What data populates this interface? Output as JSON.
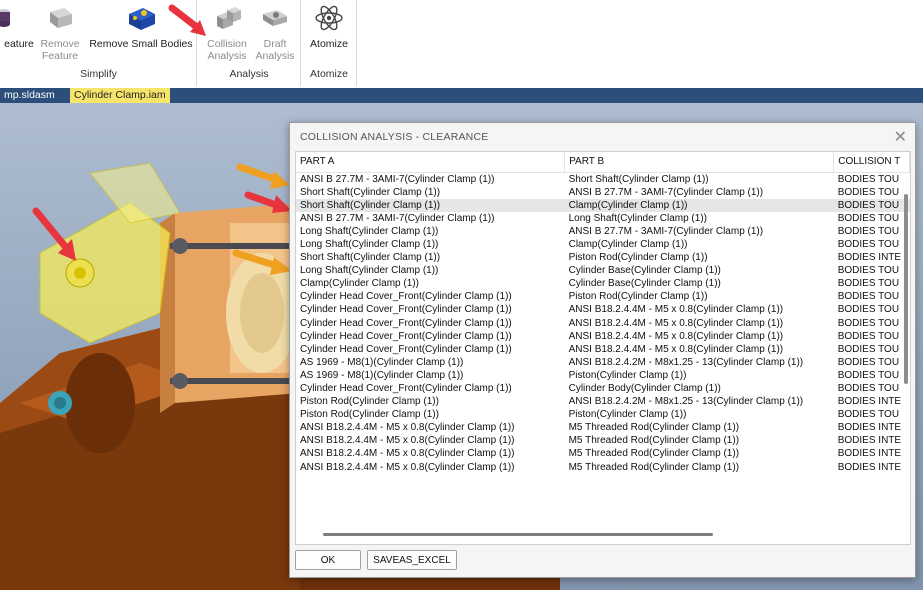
{
  "ribbon": {
    "groups": [
      {
        "label": "Simplify"
      },
      {
        "label": "Analysis"
      },
      {
        "label": "Atomize"
      }
    ],
    "buttons": {
      "feature": "eature",
      "remove_feature": "Remove\nFeature",
      "remove_small_bodies": "Remove Small Bodies",
      "collision_analysis": "Collision\nAnalysis",
      "draft_analysis": "Draft\nAnalysis",
      "atomize": "Atomize"
    }
  },
  "doc_tabs": [
    "mp.sldasm",
    "Cylinder Clamp.iam"
  ],
  "dialog": {
    "title": "COLLISION ANALYSIS - CLEARANCE",
    "columns": [
      "PART A",
      "PART B",
      "COLLISION T"
    ],
    "rows": [
      [
        "ANSI B 27.7M - 3AMI-7(Cylinder Clamp (1))",
        "Short Shaft(Cylinder Clamp (1))",
        "BODIES TOU"
      ],
      [
        "Short Shaft(Cylinder Clamp (1))",
        "ANSI B 27.7M - 3AMI-7(Cylinder Clamp (1))",
        "BODIES TOU"
      ],
      [
        "Short Shaft(Cylinder Clamp (1))",
        "Clamp(Cylinder Clamp (1))",
        "BODIES TOU"
      ],
      [
        "ANSI B 27.7M - 3AMI-7(Cylinder Clamp (1))",
        "Long Shaft(Cylinder Clamp (1))",
        "BODIES TOU"
      ],
      [
        "Long Shaft(Cylinder Clamp (1))",
        "ANSI B 27.7M - 3AMI-7(Cylinder Clamp (1))",
        "BODIES TOU"
      ],
      [
        "Long Shaft(Cylinder Clamp (1))",
        "Clamp(Cylinder Clamp (1))",
        "BODIES TOU"
      ],
      [
        "Short Shaft(Cylinder Clamp (1))",
        "Piston Rod(Cylinder Clamp (1))",
        "BODIES INTE"
      ],
      [
        "Long Shaft(Cylinder Clamp (1))",
        "Cylinder Base(Cylinder Clamp (1))",
        "BODIES TOU"
      ],
      [
        "Clamp(Cylinder Clamp (1))",
        "Cylinder Base(Cylinder Clamp (1))",
        "BODIES TOU"
      ],
      [
        "Cylinder Head Cover_Front(Cylinder Clamp (1))",
        "Piston Rod(Cylinder Clamp (1))",
        "BODIES TOU"
      ],
      [
        "Cylinder Head Cover_Front(Cylinder Clamp (1))",
        "ANSI B18.2.4.4M - M5 x 0.8(Cylinder Clamp (1))",
        "BODIES TOU"
      ],
      [
        "Cylinder Head Cover_Front(Cylinder Clamp (1))",
        "ANSI B18.2.4.4M - M5 x 0.8(Cylinder Clamp (1))",
        "BODIES TOU"
      ],
      [
        "Cylinder Head Cover_Front(Cylinder Clamp (1))",
        "ANSI B18.2.4.4M - M5 x 0.8(Cylinder Clamp (1))",
        "BODIES TOU"
      ],
      [
        "Cylinder Head Cover_Front(Cylinder Clamp (1))",
        "ANSI B18.2.4.4M - M5 x 0.8(Cylinder Clamp (1))",
        "BODIES TOU"
      ],
      [
        "AS 1969 - M8(1)(Cylinder Clamp (1))",
        "ANSI B18.2.4.2M - M8x1.25 - 13(Cylinder Clamp (1))",
        "BODIES TOU"
      ],
      [
        "AS 1969 - M8(1)(Cylinder Clamp (1))",
        "Piston(Cylinder Clamp (1))",
        "BODIES TOU"
      ],
      [
        "Cylinder Head Cover_Front(Cylinder Clamp (1))",
        "Cylinder Body(Cylinder Clamp (1))",
        "BODIES TOU"
      ],
      [
        "Piston Rod(Cylinder Clamp (1))",
        "ANSI B18.2.4.2M - M8x1.25 - 13(Cylinder Clamp (1))",
        "BODIES INTE"
      ],
      [
        "Piston Rod(Cylinder Clamp (1))",
        "Piston(Cylinder Clamp (1))",
        "BODIES TOU"
      ],
      [
        "ANSI B18.2.4.4M - M5 x 0.8(Cylinder Clamp (1))",
        "M5 Threaded Rod(Cylinder Clamp (1))",
        "BODIES INTE"
      ],
      [
        "ANSI B18.2.4.4M - M5 x 0.8(Cylinder Clamp (1))",
        "M5 Threaded Rod(Cylinder Clamp (1))",
        "BODIES INTE"
      ],
      [
        "ANSI B18.2.4.4M - M5 x 0.8(Cylinder Clamp (1))",
        "M5 Threaded Rod(Cylinder Clamp (1))",
        "BODIES INTE"
      ],
      [
        "ANSI B18.2.4.4M - M5 x 0.8(Cylinder Clamp (1))",
        "M5 Threaded Rod(Cylinder Clamp (1))",
        "BODIES INTE"
      ]
    ],
    "selected_row": 2,
    "buttons": {
      "ok": "OK",
      "save_excel": "SAVEAS_EXCEL"
    }
  },
  "colors": {
    "arrow_red": "#e8343d",
    "arrow_orange": "#f0a020",
    "tab_active": "#f7e46b",
    "doc_tab_bar": "#2b4f7a"
  }
}
